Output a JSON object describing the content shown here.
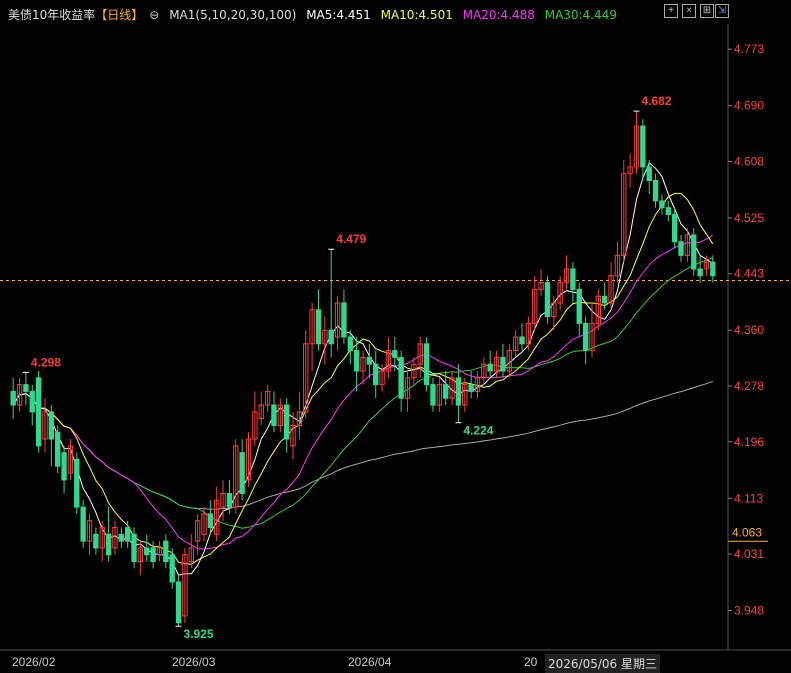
{
  "legend": {
    "title": "美债10年收益率",
    "period": "【日线】",
    "params": "MA1(5,10,20,30,100)",
    "ma5": "MA5:4.451",
    "ma10": "MA10:4.501",
    "ma20": "MA20:4.488",
    "ma30": "MA30:4.449"
  },
  "toolbar": {
    "buttons": [
      "+",
      "×",
      "⊞"
    ]
  },
  "colors": {
    "up": "#ff3b3b",
    "down": "#2ed88f",
    "ma5": "#ffffff",
    "ma10": "#ffff33",
    "ma20": "#ff33ff",
    "ma30": "#33cc33",
    "ma100": "#aaaaaa",
    "axis_text": "#ff4040",
    "current": "#ffb400"
  },
  "x_labels": [
    "2026/02",
    "2026/03",
    "2026/04",
    "20"
  ],
  "cursor_date": "2026/05/06 星期三",
  "chart_data": {
    "type": "candlestick",
    "title": "美债10年收益率",
    "y_ticks": [
      4.773,
      4.69,
      4.608,
      4.525,
      4.443,
      4.36,
      4.278,
      4.196,
      4.113,
      4.031,
      3.948
    ],
    "ylim": [
      3.89,
      4.81
    ],
    "current_price": 4.063,
    "reference_line": 4.433,
    "annotations": [
      {
        "label": "4.298",
        "value": 4.298,
        "index": 2
      },
      {
        "label": "3.925",
        "value": 3.925,
        "index": 26
      },
      {
        "label": "4.479",
        "value": 4.479,
        "index": 50
      },
      {
        "label": "4.224",
        "value": 4.224,
        "index": 70
      },
      {
        "label": "4.682",
        "value": 4.682,
        "index": 98
      }
    ],
    "candles": [
      [
        4.27,
        4.25,
        4.29,
        4.23
      ],
      [
        4.25,
        4.28,
        4.29,
        4.24
      ],
      [
        4.28,
        4.27,
        4.298,
        4.25
      ],
      [
        4.27,
        4.24,
        4.28,
        4.22
      ],
      [
        4.29,
        4.19,
        4.3,
        4.18
      ],
      [
        4.2,
        4.24,
        4.26,
        4.18
      ],
      [
        4.24,
        4.2,
        4.25,
        4.16
      ],
      [
        4.21,
        4.16,
        4.22,
        4.15
      ],
      [
        4.18,
        4.14,
        4.19,
        4.12
      ],
      [
        4.15,
        4.19,
        4.2,
        4.14
      ],
      [
        4.17,
        4.1,
        4.18,
        4.09
      ],
      [
        4.1,
        4.05,
        4.11,
        4.04
      ],
      [
        4.05,
        4.08,
        4.09,
        4.03
      ],
      [
        4.06,
        4.04,
        4.07,
        4.03
      ],
      [
        4.04,
        4.07,
        4.08,
        4.02
      ],
      [
        4.06,
        4.03,
        4.1,
        4.02
      ],
      [
        4.04,
        4.07,
        4.08,
        4.03
      ],
      [
        4.06,
        4.05,
        4.07,
        4.04
      ],
      [
        4.07,
        4.05,
        4.08,
        4.04
      ],
      [
        4.06,
        4.02,
        4.07,
        4.01
      ],
      [
        4.02,
        4.04,
        4.05,
        4.0
      ],
      [
        4.04,
        4.03,
        4.06,
        4.02
      ],
      [
        4.04,
        4.02,
        4.05,
        4.01
      ],
      [
        4.03,
        4.04,
        4.05,
        4.02
      ],
      [
        4.05,
        4.02,
        4.06,
        4.01
      ],
      [
        4.03,
        3.99,
        4.04,
        3.98
      ],
      [
        3.99,
        3.93,
        4.0,
        3.925
      ],
      [
        3.94,
        4.03,
        4.04,
        3.93
      ],
      [
        4.02,
        4.04,
        4.06,
        4.01
      ],
      [
        4.05,
        4.08,
        4.09,
        4.03
      ],
      [
        4.06,
        4.09,
        4.1,
        4.05
      ],
      [
        4.09,
        4.07,
        4.11,
        4.06
      ],
      [
        4.06,
        4.11,
        4.13,
        4.05
      ],
      [
        4.1,
        4.12,
        4.14,
        4.08
      ],
      [
        4.12,
        4.1,
        4.14,
        4.09
      ],
      [
        4.1,
        4.19,
        4.2,
        4.09
      ],
      [
        4.18,
        4.12,
        4.2,
        4.11
      ],
      [
        4.14,
        4.2,
        4.21,
        4.13
      ],
      [
        4.2,
        4.24,
        4.27,
        4.19
      ],
      [
        4.23,
        4.25,
        4.27,
        4.22
      ],
      [
        4.25,
        4.27,
        4.28,
        4.24
      ],
      [
        4.25,
        4.22,
        4.27,
        4.21
      ],
      [
        4.22,
        4.25,
        4.26,
        4.21
      ],
      [
        4.25,
        4.2,
        4.26,
        4.18
      ],
      [
        4.19,
        4.22,
        4.24,
        4.17
      ],
      [
        4.22,
        4.24,
        4.27,
        4.2
      ],
      [
        4.24,
        4.34,
        4.36,
        4.23
      ],
      [
        4.34,
        4.39,
        4.4,
        4.3
      ],
      [
        4.39,
        4.34,
        4.42,
        4.33
      ],
      [
        4.34,
        4.36,
        4.38,
        4.31
      ],
      [
        4.36,
        4.34,
        4.479,
        4.32
      ],
      [
        4.35,
        4.4,
        4.41,
        4.33
      ],
      [
        4.4,
        4.35,
        4.42,
        4.34
      ],
      [
        4.35,
        4.33,
        4.36,
        4.31
      ],
      [
        4.33,
        4.3,
        4.35,
        4.27
      ],
      [
        4.3,
        4.32,
        4.33,
        4.28
      ],
      [
        4.32,
        4.31,
        4.34,
        4.29
      ],
      [
        4.31,
        4.28,
        4.33,
        4.26
      ],
      [
        4.28,
        4.3,
        4.31,
        4.27
      ],
      [
        4.3,
        4.33,
        4.35,
        4.29
      ],
      [
        4.33,
        4.32,
        4.35,
        4.3
      ],
      [
        4.32,
        4.26,
        4.33,
        4.24
      ],
      [
        4.26,
        4.29,
        4.3,
        4.24
      ],
      [
        4.29,
        4.31,
        4.32,
        4.28
      ],
      [
        4.31,
        4.34,
        4.35,
        4.29
      ],
      [
        4.34,
        4.28,
        4.35,
        4.27
      ],
      [
        4.28,
        4.25,
        4.29,
        4.24
      ],
      [
        4.25,
        4.28,
        4.29,
        4.24
      ],
      [
        4.28,
        4.26,
        4.3,
        4.25
      ],
      [
        4.26,
        4.29,
        4.3,
        4.25
      ],
      [
        4.29,
        4.25,
        4.31,
        4.224
      ],
      [
        4.25,
        4.28,
        4.29,
        4.24
      ],
      [
        4.28,
        4.27,
        4.3,
        4.26
      ],
      [
        4.27,
        4.29,
        4.3,
        4.26
      ],
      [
        4.29,
        4.31,
        4.32,
        4.28
      ],
      [
        4.31,
        4.3,
        4.33,
        4.29
      ],
      [
        4.3,
        4.32,
        4.33,
        4.29
      ],
      [
        4.32,
        4.3,
        4.34,
        4.29
      ],
      [
        4.3,
        4.33,
        4.34,
        4.29
      ],
      [
        4.33,
        4.35,
        4.36,
        4.32
      ],
      [
        4.35,
        4.34,
        4.37,
        4.33
      ],
      [
        4.34,
        4.37,
        4.38,
        4.33
      ],
      [
        4.37,
        4.42,
        4.44,
        4.36
      ],
      [
        4.42,
        4.43,
        4.45,
        4.41
      ],
      [
        4.43,
        4.38,
        4.44,
        4.37
      ],
      [
        4.38,
        4.4,
        4.41,
        4.36
      ],
      [
        4.4,
        4.43,
        4.44,
        4.39
      ],
      [
        4.43,
        4.45,
        4.47,
        4.42
      ],
      [
        4.45,
        4.42,
        4.46,
        4.4
      ],
      [
        4.42,
        4.37,
        4.43,
        4.35
      ],
      [
        4.37,
        4.33,
        4.38,
        4.31
      ],
      [
        4.33,
        4.37,
        4.4,
        4.32
      ],
      [
        4.37,
        4.41,
        4.42,
        4.36
      ],
      [
        4.41,
        4.4,
        4.43,
        4.39
      ],
      [
        4.4,
        4.44,
        4.46,
        4.39
      ],
      [
        4.44,
        4.47,
        4.49,
        4.43
      ],
      [
        4.47,
        4.59,
        4.61,
        4.46
      ],
      [
        4.59,
        4.6,
        4.62,
        4.57
      ],
      [
        4.6,
        4.66,
        4.682,
        4.59
      ],
      [
        4.66,
        4.6,
        4.67,
        4.58
      ],
      [
        4.6,
        4.58,
        4.61,
        4.56
      ],
      [
        4.58,
        4.55,
        4.59,
        4.54
      ],
      [
        4.55,
        4.54,
        4.56,
        4.53
      ],
      [
        4.54,
        4.53,
        4.55,
        4.52
      ],
      [
        4.53,
        4.49,
        4.54,
        4.48
      ],
      [
        4.49,
        4.47,
        4.5,
        4.46
      ],
      [
        4.47,
        4.5,
        4.51,
        4.46
      ],
      [
        4.5,
        4.45,
        4.51,
        4.44
      ],
      [
        4.45,
        4.44,
        4.47,
        4.43
      ],
      [
        4.45,
        4.46,
        4.47,
        4.44
      ],
      [
        4.46,
        4.44,
        4.47,
        4.43
      ]
    ]
  }
}
